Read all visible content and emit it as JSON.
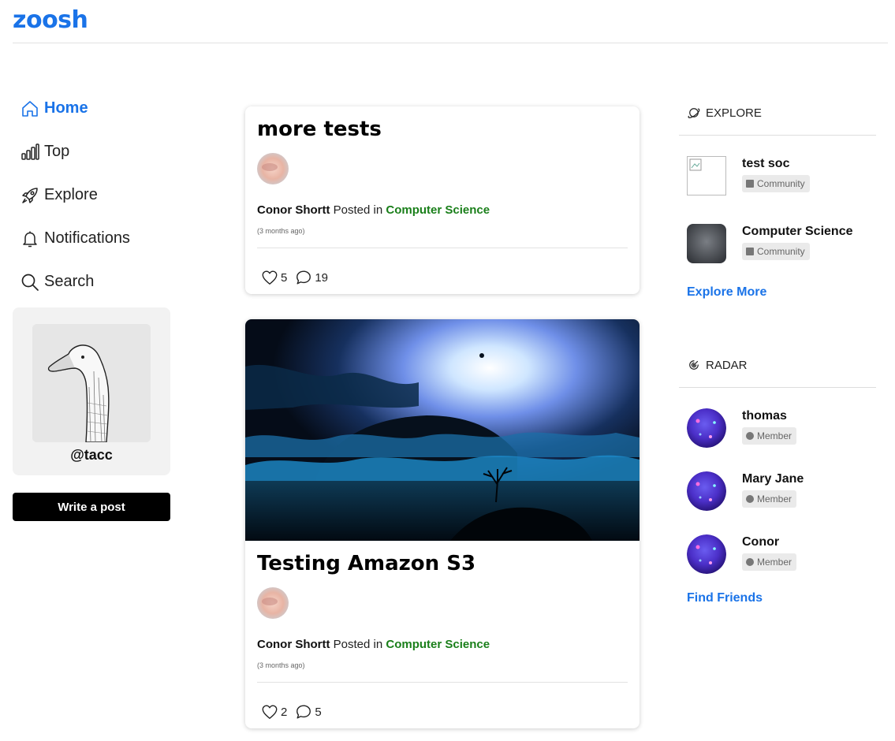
{
  "app": {
    "logo": "zoosh"
  },
  "nav": {
    "items": [
      {
        "label": "Home",
        "icon": "home-icon",
        "active": true
      },
      {
        "label": "Top",
        "icon": "bar-chart-icon"
      },
      {
        "label": "Explore",
        "icon": "rocket-icon"
      },
      {
        "label": "Notifications",
        "icon": "bell-icon"
      },
      {
        "label": "Search",
        "icon": "search-icon"
      }
    ]
  },
  "profile": {
    "handle": "@tacc",
    "avatar": "goose-sketch"
  },
  "write_post": {
    "label": "Write a post"
  },
  "posts": [
    {
      "title": "more tests",
      "author": "Conor Shortt",
      "posted_in": "Posted in",
      "community": "Computer Science",
      "time": "(3 months ago)",
      "likes": "5",
      "comments": "19"
    },
    {
      "title": "Testing Amazon S3",
      "author": "Conor Shortt",
      "posted_in": "Posted in",
      "community": "Computer Science",
      "time": "(3 months ago)",
      "likes": "2",
      "comments": "5"
    }
  ],
  "explore": {
    "heading": "EXPLORE",
    "items": [
      {
        "name": "test soc",
        "badge": "Community"
      },
      {
        "name": "Computer Science",
        "badge": "Community"
      }
    ],
    "more": "Explore More"
  },
  "radar": {
    "heading": "RADAR",
    "items": [
      {
        "name": "thomas",
        "badge": "Member"
      },
      {
        "name": "Mary Jane",
        "badge": "Member"
      },
      {
        "name": "Conor",
        "badge": "Member"
      }
    ],
    "more": "Find Friends"
  },
  "colors": {
    "brand": "#1a73e8",
    "community_link": "#1a7f1a",
    "button_bg": "#000000"
  }
}
